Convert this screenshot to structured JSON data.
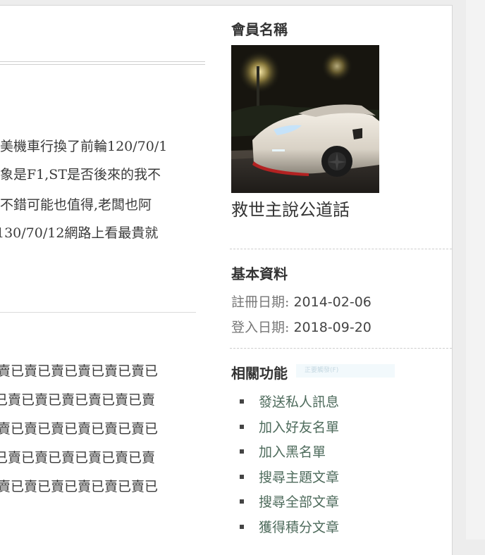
{
  "post": {
    "lines": [
      "美機車行換了前輪120/70/1",
      "象是F1,ST是否後來的我不",
      "不錯可能也值得,老闆也阿",
      "130/70/12網路上看最貴就"
    ],
    "sold_lines": [
      "賣已賣已賣已賣已賣已賣已",
      "已賣已賣已賣已賣已賣已賣",
      "賣已賣已賣已賣已賣已賣已",
      "已賣已賣已賣已賣已賣已賣",
      "賣已賣已賣已賣已賣已賣已"
    ]
  },
  "sidebar": {
    "member_heading": "會員名稱",
    "username": "救世主說公道話",
    "basic_heading": "基本資料",
    "register_label": "註冊日期: ",
    "register_date": "2014-02-06",
    "login_label": "登入日期: ",
    "login_date": "2018-09-20",
    "functions_heading": "相關功能",
    "tooltip_hint": "正要觸發(F)",
    "functions": [
      "發送私人訊息",
      "加入好友名單",
      "加入黑名單",
      "搜尋主題文章",
      "搜尋全部文章",
      "獲得積分文章"
    ]
  }
}
